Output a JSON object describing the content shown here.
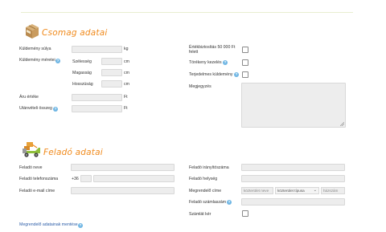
{
  "package": {
    "title": "Csomag adatai",
    "weight_label": "Küldemény súlya",
    "weight_unit": "kg",
    "dimensions_label": "Küldemény méretei",
    "width_label": "Szélesség",
    "height_label": "Magasság",
    "length_label": "Hosszúság",
    "dim_unit": "cm",
    "value_label": "Áru értéke",
    "value_unit": "Ft",
    "cod_label": "Utánvételi összeg",
    "cod_unit": "Ft",
    "insurance_label_line1": "Értékbiztosítás 50 000 Ft",
    "insurance_label_line2": "felett",
    "fragile_label": "Törékeny kezelés",
    "bulky_label": "Terjedelmes küldemény",
    "note_label": "Megjegyzés"
  },
  "sender": {
    "title": "Feladó adatai",
    "name_label": "Feladó neve",
    "phone_label": "Feladó telefonszáma",
    "phone_prefix": "+36",
    "email_label": "Feladó e-mail címe",
    "zip_label": "Feladó irányítószáma",
    "city_label": "Feladó helység",
    "address_label": "Megrendelő címe",
    "street_placeholder": "közterület neve",
    "street_type_value": "közterület típusa",
    "house_placeholder": "házszám",
    "account_label": "Feladó számlaszám",
    "invoice_label": "Számlát kér"
  },
  "footer": {
    "save_link": "Megrendelő adatainak mentése"
  },
  "help_glyph": "?",
  "colors": {
    "accent": "#f08a1c",
    "help": "#6fb6e4",
    "link": "#2d5ea8",
    "input_bg": "#ededed"
  },
  "icons": {
    "package": "package-box-icon",
    "sender": "delivery-truck-icon"
  }
}
